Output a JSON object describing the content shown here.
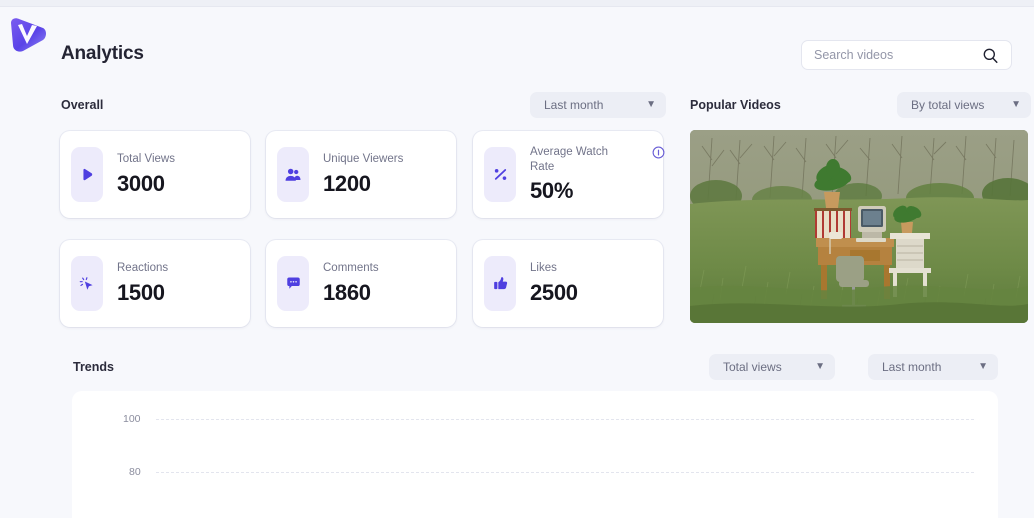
{
  "app": {
    "logo_name": "video-platform-logo",
    "title": "Analytics"
  },
  "search": {
    "placeholder": "Search videos",
    "value": "",
    "icon": "search-icon"
  },
  "overall": {
    "heading": "Overall",
    "range_filter": "Last month",
    "cards": [
      {
        "label": "Total Views",
        "value": "3000",
        "icon": "play-icon",
        "has_info": false
      },
      {
        "label": "Unique Viewers",
        "value": "1200",
        "icon": "users-icon",
        "has_info": false
      },
      {
        "label": "Average Watch Rate",
        "value": "50%",
        "icon": "percent-icon",
        "has_info": true
      },
      {
        "label": "Reactions",
        "value": "1500",
        "icon": "cursor-click-icon",
        "has_info": false
      },
      {
        "label": "Comments",
        "value": "1860",
        "icon": "comment-icon",
        "has_info": false
      },
      {
        "label": "Likes",
        "value": "2500",
        "icon": "thumbs-up-icon",
        "has_info": false
      }
    ]
  },
  "popular": {
    "heading": "Popular Videos",
    "sort_filter": "By total views",
    "thumbnail_alt": "desk with computer and binders in a grassy field"
  },
  "trends": {
    "heading": "Trends",
    "metric_filter": "Total views",
    "range_filter": "Last month"
  },
  "chart_data": {
    "type": "line",
    "title": "Trends",
    "xlabel": "",
    "ylabel": "",
    "ylim": [
      0,
      100
    ],
    "yticks": [
      100,
      80
    ],
    "ytick_labels": [
      "100",
      "80"
    ],
    "grid": true,
    "grid_style": "dashed",
    "legend": "none",
    "series": [],
    "categories": [],
    "note": "Chart is cut off by the viewport; only the 100 and 80 gridlines are visible."
  },
  "colors": {
    "accent": "#4f3fe0",
    "icon_tile_bg": "#edebfb",
    "page_bg": "#f7f8fc",
    "card_bg": "#ffffff",
    "pill_bg": "#eceef5",
    "text_primary": "#16161f",
    "text_muted": "#72748a"
  }
}
